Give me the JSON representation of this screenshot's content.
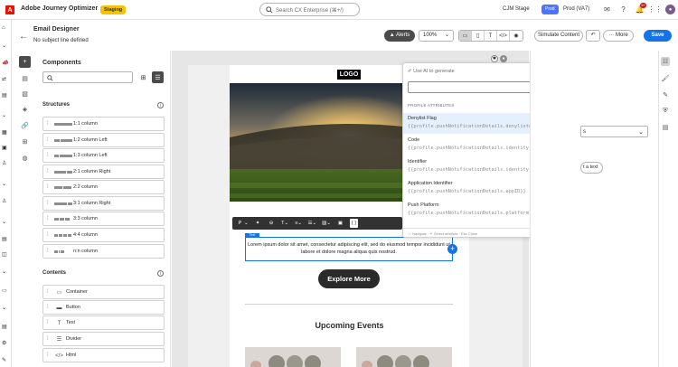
{
  "topbar": {
    "app_name": "Adobe Journey Optimizer",
    "staging": "Staging",
    "search_placeholder": "Search CX Enterprise (⌘+/)",
    "stage": "CJM Stage",
    "prod_badge": "Prod",
    "prod_sandbox": "Prod (VA7)",
    "notification_count": "9+"
  },
  "header": {
    "title": "Email Designer",
    "subtitle": "No subject line defined",
    "alerts_label": "Alerts",
    "zoom": "100%",
    "simulate_label": "Simulate Content",
    "more_label": "More",
    "save_label": "Save"
  },
  "components": {
    "title": "Components",
    "structures_title": "Structures",
    "structures": [
      "1:1 column",
      "1:2 column Left",
      "1:3 column Left",
      "2:1 column Right",
      "2:2 column",
      "3:1 column Right",
      "3:3 column",
      "4:4 column",
      "n:n column"
    ],
    "contents_title": "Contents",
    "contents": [
      "Container",
      "Button",
      "Text",
      "Divider",
      "Html"
    ]
  },
  "email": {
    "logo": "LOGO",
    "text_tag": "Text",
    "lorem": "Lorem ipsum dolor sit amet, consectetur adipiscing elit, sed do eiusmod tempor incididunt ut labore et dolore magna aliqua quis nostrud.",
    "cta": "Explore More",
    "upcoming": "Upcoming Events"
  },
  "rte_toolbar": {
    "p_label": "P"
  },
  "personalization": {
    "ai_label": "Use AI to generate",
    "section": "PROFILE ATTRIBUTES",
    "items": [
      {
        "name": "Denylist Flag",
        "value": "{{profile.pushNotificationDetails.denylisted}}"
      },
      {
        "name": "Code",
        "value": "{{profile.pushNotificationDetails.identity.namespace.cod…"
      },
      {
        "name": "Identifier",
        "value": "{{profile.pushNotificationDetails.identity.id}}"
      },
      {
        "name": "Application Identifier",
        "value": "{{profile.pushNotificationDetails.appID}}"
      },
      {
        "name": "Push Platform",
        "value": "{{profile.pushNotificationDetails.platform}}"
      }
    ],
    "footer": "↑↓ Navigate · ↵ Select attribute · Esc Close",
    "terms": "Generative AI Terms"
  },
  "right_panel": {
    "add_text_label": "t a text"
  },
  "colors": {
    "accent": "#1473e6",
    "staging": "#f5c400",
    "prod": "#4b75ff",
    "brand": "#eb1000"
  }
}
